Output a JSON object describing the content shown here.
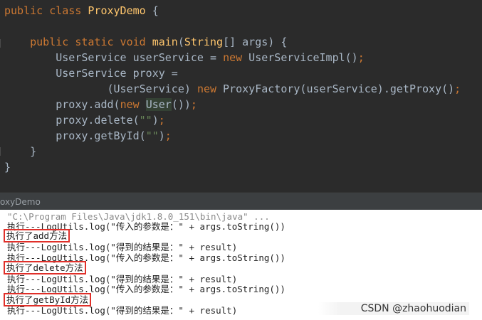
{
  "editor": {
    "lines": [
      {
        "kw1": "public class ",
        "name": "ProxyDemo",
        "rest": " {"
      },
      {
        "indent": "    ",
        "kw1": "public static void ",
        "fn": "main",
        "p1": "(",
        "type": "String",
        "p2": "[] args) {"
      },
      {
        "indent": "        ",
        "t1": "UserService userService = ",
        "kw": "new",
        "t2": " UserServiceImpl()",
        "semi": ";"
      },
      {
        "indent": "        ",
        "t1": "UserService proxy ="
      },
      {
        "indent": "                ",
        "t1": "(UserService) ",
        "kw": "new",
        "t2": " ProxyFactory(userService).getProxy()",
        "semi": ";"
      },
      {
        "indent": "        ",
        "t1": "proxy.add(",
        "kw": "new",
        "sp": " ",
        "hl": "User",
        "t2": "())",
        "semi": ";"
      },
      {
        "indent": "        ",
        "t1": "proxy.delete(",
        "str": "\"\"",
        "t2": ")",
        "semi": ";"
      },
      {
        "indent": "        ",
        "t1": "proxy.getById(",
        "str": "\"\"",
        "t2": ")",
        "semi": ";"
      },
      {
        "indent": "    ",
        "t1": "}"
      },
      {
        "indent": "",
        "t1": "}"
      }
    ]
  },
  "run_panel": {
    "title": "oxyDemo"
  },
  "console": {
    "lines": [
      {
        "text": "\"C:\\Program Files\\Java\\jdk1.8.0_151\\bin\\java\" ...",
        "style": "cmd"
      },
      {
        "text": "执行---LogUtils.log(\"传入的参数是：\" + args.toString())",
        "style": "normal"
      },
      {
        "text": "执行了add方法",
        "style": "boxed"
      },
      {
        "text": "执行---LogUtils.log(\"得到的结果是：\" + result)",
        "style": "normal"
      },
      {
        "text": "执行---LogUtils.log(\"传入的参数是：\" + args.toString())",
        "style": "normal"
      },
      {
        "text": "执行了delete方法",
        "style": "boxed"
      },
      {
        "text": "执行---LogUtils.log(\"得到的结果是：\" + result)",
        "style": "normal"
      },
      {
        "text": "执行---LogUtils.log(\"传入的参数是：\" + args.toString())",
        "style": "normal"
      },
      {
        "text": "执行了getById方法",
        "style": "boxed"
      },
      {
        "text": "执行---LogUtils.log(\"得到的结果是：\" + result)",
        "style": "normal"
      }
    ]
  },
  "watermark": "CSDN @zhaohuodian"
}
